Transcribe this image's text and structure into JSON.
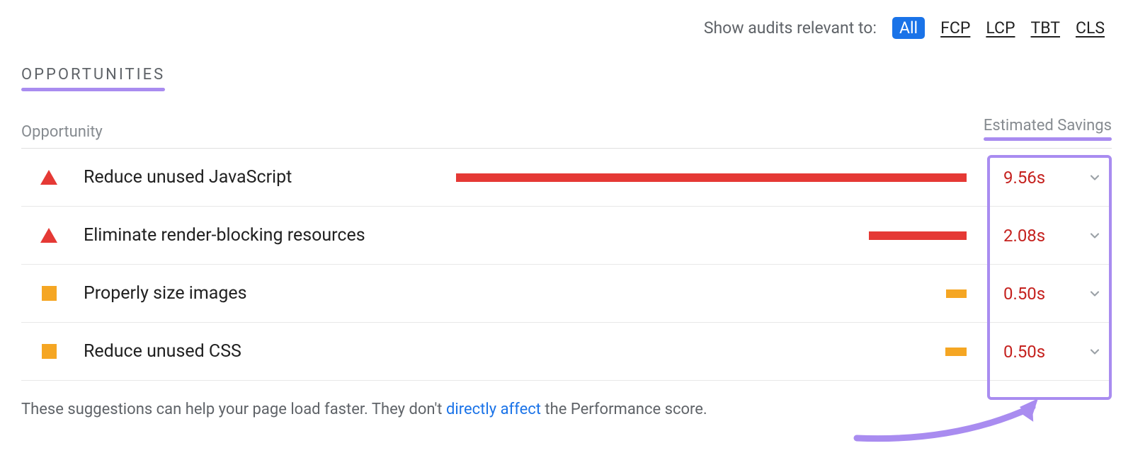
{
  "filter": {
    "label": "Show audits relevant to:",
    "tabs": [
      "All",
      "FCP",
      "LCP",
      "TBT",
      "CLS"
    ],
    "active": "All"
  },
  "section": {
    "heading": "OPPORTUNITIES"
  },
  "table": {
    "col_opportunity": "Opportunity",
    "col_savings": "Estimated Savings"
  },
  "opportunities": [
    {
      "status": "fail",
      "title": "Reduce unused JavaScript",
      "savings": "9.56s",
      "bar_pct": 79,
      "bar_color": "red"
    },
    {
      "status": "fail",
      "title": "Eliminate render-blocking resources",
      "savings": "2.08s",
      "bar_pct": 17,
      "bar_color": "red"
    },
    {
      "status": "warn",
      "title": "Properly size images",
      "savings": "0.50s",
      "bar_pct": 3,
      "bar_color": "orange"
    },
    {
      "status": "warn",
      "title": "Reduce unused CSS",
      "savings": "0.50s",
      "bar_pct": 3,
      "bar_color": "orange"
    }
  ],
  "footnote": {
    "pre": "These suggestions can help your page load faster. They don't ",
    "link": "directly affect",
    "post": " the Performance score."
  }
}
